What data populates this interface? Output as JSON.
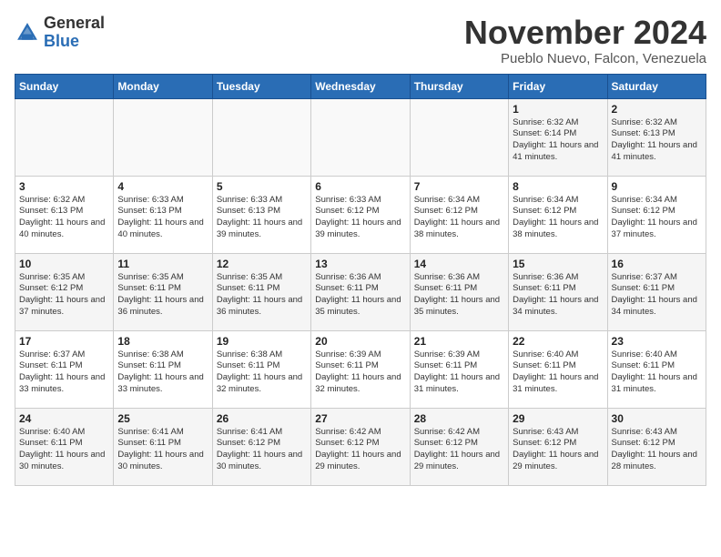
{
  "header": {
    "logo_general": "General",
    "logo_blue": "Blue",
    "month_title": "November 2024",
    "subtitle": "Pueblo Nuevo, Falcon, Venezuela"
  },
  "days_of_week": [
    "Sunday",
    "Monday",
    "Tuesday",
    "Wednesday",
    "Thursday",
    "Friday",
    "Saturday"
  ],
  "weeks": [
    [
      {
        "day": "",
        "content": ""
      },
      {
        "day": "",
        "content": ""
      },
      {
        "day": "",
        "content": ""
      },
      {
        "day": "",
        "content": ""
      },
      {
        "day": "",
        "content": ""
      },
      {
        "day": "1",
        "content": "Sunrise: 6:32 AM\nSunset: 6:14 PM\nDaylight: 11 hours and 41 minutes."
      },
      {
        "day": "2",
        "content": "Sunrise: 6:32 AM\nSunset: 6:13 PM\nDaylight: 11 hours and 41 minutes."
      }
    ],
    [
      {
        "day": "3",
        "content": "Sunrise: 6:32 AM\nSunset: 6:13 PM\nDaylight: 11 hours and 40 minutes."
      },
      {
        "day": "4",
        "content": "Sunrise: 6:33 AM\nSunset: 6:13 PM\nDaylight: 11 hours and 40 minutes."
      },
      {
        "day": "5",
        "content": "Sunrise: 6:33 AM\nSunset: 6:13 PM\nDaylight: 11 hours and 39 minutes."
      },
      {
        "day": "6",
        "content": "Sunrise: 6:33 AM\nSunset: 6:12 PM\nDaylight: 11 hours and 39 minutes."
      },
      {
        "day": "7",
        "content": "Sunrise: 6:34 AM\nSunset: 6:12 PM\nDaylight: 11 hours and 38 minutes."
      },
      {
        "day": "8",
        "content": "Sunrise: 6:34 AM\nSunset: 6:12 PM\nDaylight: 11 hours and 38 minutes."
      },
      {
        "day": "9",
        "content": "Sunrise: 6:34 AM\nSunset: 6:12 PM\nDaylight: 11 hours and 37 minutes."
      }
    ],
    [
      {
        "day": "10",
        "content": "Sunrise: 6:35 AM\nSunset: 6:12 PM\nDaylight: 11 hours and 37 minutes."
      },
      {
        "day": "11",
        "content": "Sunrise: 6:35 AM\nSunset: 6:11 PM\nDaylight: 11 hours and 36 minutes."
      },
      {
        "day": "12",
        "content": "Sunrise: 6:35 AM\nSunset: 6:11 PM\nDaylight: 11 hours and 36 minutes."
      },
      {
        "day": "13",
        "content": "Sunrise: 6:36 AM\nSunset: 6:11 PM\nDaylight: 11 hours and 35 minutes."
      },
      {
        "day": "14",
        "content": "Sunrise: 6:36 AM\nSunset: 6:11 PM\nDaylight: 11 hours and 35 minutes."
      },
      {
        "day": "15",
        "content": "Sunrise: 6:36 AM\nSunset: 6:11 PM\nDaylight: 11 hours and 34 minutes."
      },
      {
        "day": "16",
        "content": "Sunrise: 6:37 AM\nSunset: 6:11 PM\nDaylight: 11 hours and 34 minutes."
      }
    ],
    [
      {
        "day": "17",
        "content": "Sunrise: 6:37 AM\nSunset: 6:11 PM\nDaylight: 11 hours and 33 minutes."
      },
      {
        "day": "18",
        "content": "Sunrise: 6:38 AM\nSunset: 6:11 PM\nDaylight: 11 hours and 33 minutes."
      },
      {
        "day": "19",
        "content": "Sunrise: 6:38 AM\nSunset: 6:11 PM\nDaylight: 11 hours and 32 minutes."
      },
      {
        "day": "20",
        "content": "Sunrise: 6:39 AM\nSunset: 6:11 PM\nDaylight: 11 hours and 32 minutes."
      },
      {
        "day": "21",
        "content": "Sunrise: 6:39 AM\nSunset: 6:11 PM\nDaylight: 11 hours and 31 minutes."
      },
      {
        "day": "22",
        "content": "Sunrise: 6:40 AM\nSunset: 6:11 PM\nDaylight: 11 hours and 31 minutes."
      },
      {
        "day": "23",
        "content": "Sunrise: 6:40 AM\nSunset: 6:11 PM\nDaylight: 11 hours and 31 minutes."
      }
    ],
    [
      {
        "day": "24",
        "content": "Sunrise: 6:40 AM\nSunset: 6:11 PM\nDaylight: 11 hours and 30 minutes."
      },
      {
        "day": "25",
        "content": "Sunrise: 6:41 AM\nSunset: 6:11 PM\nDaylight: 11 hours and 30 minutes."
      },
      {
        "day": "26",
        "content": "Sunrise: 6:41 AM\nSunset: 6:12 PM\nDaylight: 11 hours and 30 minutes."
      },
      {
        "day": "27",
        "content": "Sunrise: 6:42 AM\nSunset: 6:12 PM\nDaylight: 11 hours and 29 minutes."
      },
      {
        "day": "28",
        "content": "Sunrise: 6:42 AM\nSunset: 6:12 PM\nDaylight: 11 hours and 29 minutes."
      },
      {
        "day": "29",
        "content": "Sunrise: 6:43 AM\nSunset: 6:12 PM\nDaylight: 11 hours and 29 minutes."
      },
      {
        "day": "30",
        "content": "Sunrise: 6:43 AM\nSunset: 6:12 PM\nDaylight: 11 hours and 28 minutes."
      }
    ]
  ]
}
